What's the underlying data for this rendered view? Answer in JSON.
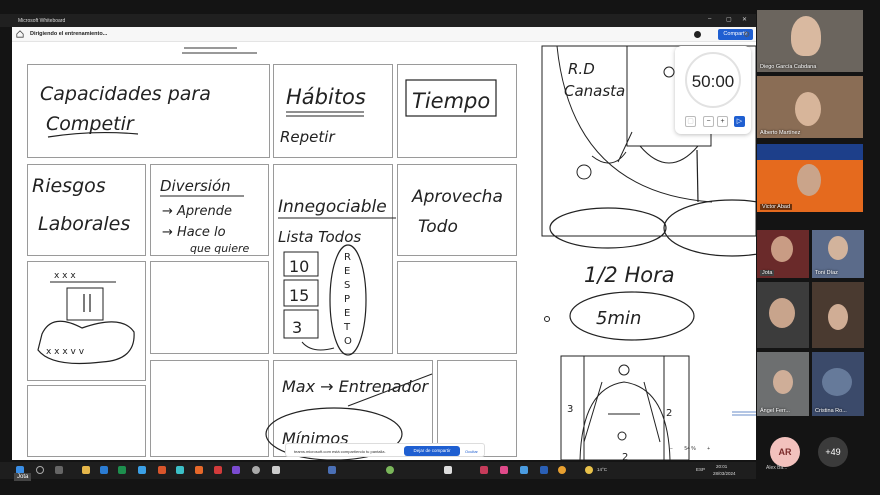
{
  "window": {
    "title": "Microsoft Whiteboard"
  },
  "appbar": {
    "document_title": "Dirigiendo el entrenamiento...",
    "share_label": "Compartir"
  },
  "timer": {
    "value": "50:00",
    "minus": "−",
    "plus": "+"
  },
  "whiteboard": {
    "cells": {
      "capacidades": [
        "Capacidades para",
        "Competir"
      ],
      "habitos": [
        "Hábitos",
        "Repetir"
      ],
      "tiempo": "Tiempo",
      "riesgos": [
        "Riesgos",
        "Laborales"
      ],
      "diversion": [
        "Diversión",
        "→ Aprende",
        "→ Hace lo",
        "que quiere"
      ],
      "innegociable": [
        "Innegociable",
        "Lista Todos"
      ],
      "lista_nums": [
        "10",
        "15",
        "3"
      ],
      "respeto": [
        "R",
        "E",
        "S",
        "P",
        "E",
        "T",
        "O"
      ],
      "aprovecha": [
        "Aprovecha",
        "Todo"
      ],
      "max": "Max → Entrenador",
      "minimos": "Mínimos"
    },
    "court": {
      "label_rd": "R.D",
      "label_canasta": "Canasta"
    },
    "media_hora": "1/2 Hora",
    "cinco_min": "5min",
    "small_labels": [
      "3",
      "2",
      "2"
    ]
  },
  "sharebar": {
    "message": "teams.microsoft.com está compartiendo tu pantalla.",
    "stop_label": "Dejar de compartir",
    "hide_label": "Ocultar"
  },
  "zoom": {
    "level": "54 %"
  },
  "taskbar": {
    "weather": "14°C",
    "lang": "ESP",
    "time": "20:01",
    "date": "28/03/2024"
  },
  "presenter_label": "Jota",
  "participants": [
    {
      "name": "Diego García Cabdana",
      "bg": "#6b655e"
    },
    {
      "name": "Alberto Martínez",
      "bg": "#8a6d55"
    },
    {
      "name": "Victor Abad",
      "bg": "#e56a1e"
    },
    {
      "name": "Jota",
      "bg": "#6a2a2a"
    },
    {
      "name": "Toni Díaz",
      "bg": "#5b6b8a"
    },
    {
      "name": "",
      "bg": "#3c3c3c"
    },
    {
      "name": "",
      "bg": "#4a3a30"
    },
    {
      "name": "Ángel Ferr...",
      "bg": "#6d6f70"
    },
    {
      "name": "Cristina Ro...",
      "bg": "#3b4a6a"
    }
  ],
  "avatar": {
    "initials": "AR",
    "name": "Alex Ba...",
    "more": "+49"
  }
}
